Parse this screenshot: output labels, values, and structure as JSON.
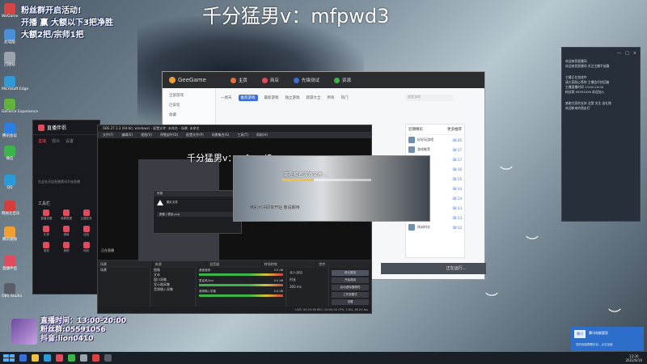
{
  "overlay": {
    "top_title": "千分猛男v：mfpwd3",
    "promo_lines": [
      "粉丝群开启活动!",
      "开播 赢 大额以下3把净胜",
      "大额2把/宗师1把"
    ],
    "schedule_lines": [
      "直播时间：13:00-20:00",
      "粉丝群:05591056",
      "抖音:lion0410"
    ]
  },
  "desktop_icons": [
    {
      "label": "WeGame",
      "color": "#d64545"
    },
    {
      "label": "此电脑",
      "color": "#4a8fd6"
    },
    {
      "label": "回收站",
      "color": "#9aa4ad"
    },
    {
      "label": "Microsoft Edge",
      "color": "#2f9ad6"
    },
    {
      "label": "GeForce Experience",
      "color": "#62b33a"
    },
    {
      "label": "腾讯会议",
      "color": "#2a7fe0"
    },
    {
      "label": "微信",
      "color": "#3bb54a"
    },
    {
      "label": "QQ",
      "color": "#2a9bd8"
    },
    {
      "label": "网易云音乐",
      "color": "#d63d3d"
    },
    {
      "label": "腾讯视频",
      "color": "#f0a030"
    },
    {
      "label": "直播伴侣",
      "color": "#e24b5d"
    },
    {
      "label": "OBS Studio",
      "color": "#5a5e66"
    }
  ],
  "geegame": {
    "brand": "GeeGame",
    "tabs": [
      {
        "label": "主页",
        "color": "#e86d3a"
      },
      {
        "label": "商店",
        "color": "#e24b5d"
      },
      {
        "label": "先锋测试",
        "color": "#3a6fd8"
      },
      {
        "label": "资源",
        "color": "#3bb54a"
      }
    ],
    "side_items": [
      "全部游戏",
      "已安装",
      "收藏"
    ],
    "subtabs": [
      "一周天",
      "推荐游戏",
      "最新游戏",
      "独立游戏",
      "新游大全",
      "所有",
      "热门"
    ],
    "search_placeholder": "搜索游戏",
    "list_title": "近期精彩",
    "list_more": "更多推荐",
    "list_rows": [
      {
        "name": "好好玩游戏",
        "time": "08:45"
      },
      {
        "name": "游戏推荐",
        "time": "08:17"
      },
      {
        "name": "战斗挑战",
        "time": "08:17"
      },
      {
        "name": "热门精选",
        "time": "08:16"
      },
      {
        "name": "全新体验",
        "time": "08:15"
      },
      {
        "name": "冒险之旅",
        "time": "08:14"
      },
      {
        "name": "策略对决",
        "time": "08:14"
      },
      {
        "name": "经典回归",
        "time": "08:13"
      },
      {
        "name": "多人竞技",
        "time": "08:13"
      },
      {
        "name": "休闲时光",
        "time": "08:12"
      }
    ],
    "bottom_button": "正在运行..."
  },
  "assistant": {
    "title": "直播伴侣",
    "tabs": [
      "直播",
      "观众",
      "设置"
    ],
    "hint": "在此处添加直播素材开始直播",
    "tools_label": "工具栏",
    "tools": [
      "直播设置",
      "观看数据",
      "主播任务",
      "礼物",
      "弹幕",
      "连线",
      "音效",
      "美颜",
      "特效"
    ]
  },
  "obs": {
    "title": "OBS 27.1.3 (64-bit, windows) - 配置文件: 未命名 - 场景: 未命名",
    "menu": [
      "文件(F)",
      "编辑(E)",
      "视图(V)",
      "停靠部件(D)",
      "配置文件(P)",
      "场景集合(S)",
      "工具(T)",
      "帮助(H)"
    ],
    "preview_label": "正在直播",
    "docks": [
      "场景",
      "来源",
      "混音器",
      "转场特效",
      "控件"
    ],
    "scenes": [
      "场景"
    ],
    "sources": [
      "图像",
      "文本",
      "窗口采集",
      "显示器采集",
      "音频输入采集"
    ],
    "mixer": [
      {
        "name": "桌面音频",
        "db": "0.0 dB"
      },
      {
        "name": "麦克风/Aux",
        "db": "0.0 dB"
      },
      {
        "name": "音频输入采集",
        "db": "0.0 dB"
      }
    ],
    "transition": [
      "淡入淡出",
      "时长",
      "300 ms"
    ],
    "controls": [
      "停止推流",
      "开始录制",
      "启动虚拟摄像机",
      "工作室模式",
      "设置",
      "退出"
    ],
    "status": "LIVE: 00:25:38   REC: 00:00:00   CPU: 2.6%, 60.00 fps",
    "nested_title": "千分猛男v：mfpwd3",
    "dialog_title": "来源",
    "dialog_msg": "图片文件",
    "dialog_field": "图像 | 壁纸.png"
  },
  "loader": {
    "text": "正在检查游戏文件...",
    "progress_fraction": 0.35,
    "mid_text": "精彩对决即将开始 敬请期待",
    "note": "正在检查游戏文件，请耐心等待"
  },
  "right_panel": {
    "head": [
      "—",
      "□",
      "×"
    ],
    "blocks": [
      [
        "欢迎来到直播间",
        "欢迎来到直播间 关注主播不迷路"
      ],
      [
        "主播正在游戏中",
        "请大家耐心等待 主播会尽快回复",
        "主播直播时间 13:00-20:00",
        "粉丝群 05591056 欢迎加入"
      ],
      [
        "感谢大家的支持 点赞 关注 送礼物",
        "欢迎新来的朋友们"
      ]
    ]
  },
  "notification": {
    "icon_text": "腾讯",
    "title": "腾讯电脑管家",
    "body": "您的电脑需要优化，点击加速"
  },
  "taskbar": {
    "apps": [
      "#3a6fd8",
      "#f0c040",
      "#2f9ad6",
      "#e24b5d",
      "#3bb54a",
      "#9aa4ad",
      "#d64545",
      "#5a5e66"
    ],
    "time": "13:30",
    "date": "2022/6/16"
  }
}
